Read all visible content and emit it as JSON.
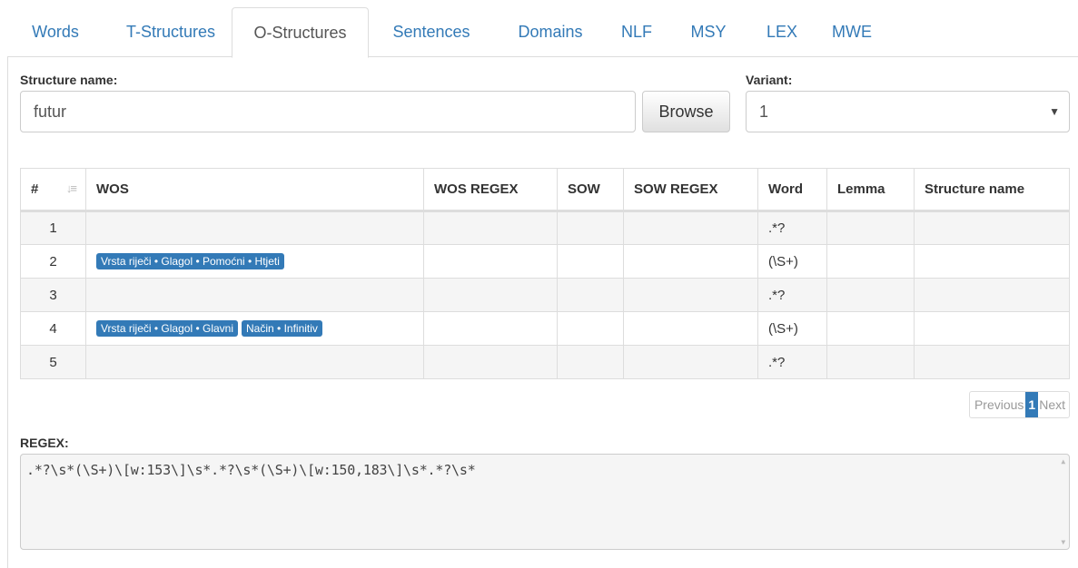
{
  "tabs": [
    {
      "label": "Words"
    },
    {
      "label": "T-Structures"
    },
    {
      "label": "O-Structures"
    },
    {
      "label": "Sentences"
    },
    {
      "label": "Domains"
    },
    {
      "label": "NLF"
    },
    {
      "label": "MSY"
    },
    {
      "label": "LEX"
    },
    {
      "label": "MWE"
    }
  ],
  "active_tab": "O-Structures",
  "form": {
    "structure_label": "Structure name:",
    "structure_value": "futur",
    "browse_label": "Browse",
    "variant_label": "Variant:",
    "variant_value": "1"
  },
  "table": {
    "headers": [
      "#",
      "WOS",
      "WOS REGEX",
      "SOW",
      "SOW REGEX",
      "Word",
      "Lemma",
      "Structure name"
    ],
    "rows": [
      {
        "num": "1",
        "wos": [],
        "word": ".*?"
      },
      {
        "num": "2",
        "wos": [
          "Vrsta riječi • Glagol • Pomoćni • Htjeti"
        ],
        "word": "(\\S+)"
      },
      {
        "num": "3",
        "wos": [],
        "word": ".*?"
      },
      {
        "num": "4",
        "wos": [
          "Vrsta riječi • Glagol • Glavni",
          "Način • Infinitiv"
        ],
        "word": "(\\S+)"
      },
      {
        "num": "5",
        "wos": [],
        "word": ".*?"
      }
    ]
  },
  "pagination": {
    "previous": "Previous",
    "current": "1",
    "next": "Next"
  },
  "regex": {
    "label": "REGEX:",
    "value": ".*?\\s*(\\S+)\\[w:153\\]\\s*.*?\\s*(\\S+)\\[w:150,183\\]\\s*.*?\\s*"
  },
  "colors": {
    "accent": "#337ab7",
    "tag_bg": "#337ab7"
  }
}
